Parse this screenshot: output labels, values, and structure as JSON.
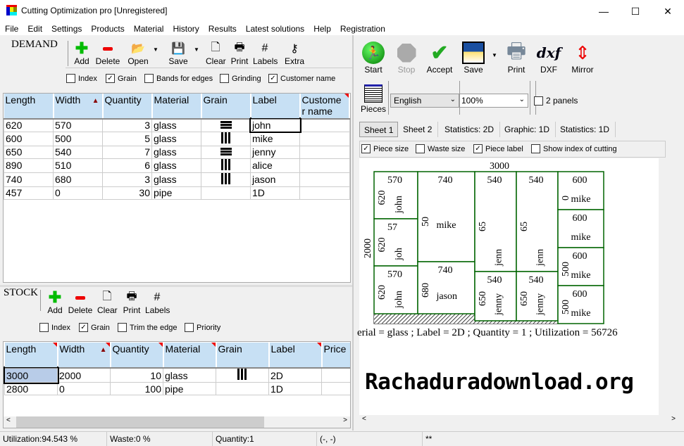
{
  "window": {
    "title": "Cutting Optimization pro [Unregistered]",
    "minimize": "—",
    "maximize": "☐",
    "close": "✕"
  },
  "menu": [
    "File",
    "Edit",
    "Settings",
    "Products",
    "Material",
    "History",
    "Results",
    "Latest solutions",
    "Help",
    "Registration"
  ],
  "demand": {
    "title": "DEMAND",
    "toolbar": {
      "add": "Add",
      "delete": "Delete",
      "open": "Open",
      "save": "Save",
      "clear": "Clear",
      "print": "Print",
      "labels": "Labels",
      "extra": "Extra"
    },
    "options": [
      {
        "label": "Index",
        "checked": false
      },
      {
        "label": "Grain",
        "checked": true
      },
      {
        "label": "Bands for edges",
        "checked": false
      },
      {
        "label": "Grinding",
        "checked": false
      },
      {
        "label": "Customer name",
        "checked": true
      }
    ],
    "columns": [
      "Length",
      "Width",
      "Quantity",
      "Material",
      "Grain",
      "Label",
      "Custome r name"
    ],
    "rows": [
      {
        "length": "620",
        "width": "570",
        "quantity": "3",
        "material": "glass",
        "grain": "horizontal",
        "label": "john",
        "customer": ""
      },
      {
        "length": "600",
        "width": "500",
        "quantity": "5",
        "material": "glass",
        "grain": "vertical",
        "label": "mike",
        "customer": ""
      },
      {
        "length": "650",
        "width": "540",
        "quantity": "7",
        "material": "glass",
        "grain": "horizontal",
        "label": "jenny",
        "customer": ""
      },
      {
        "length": "890",
        "width": "510",
        "quantity": "6",
        "material": "glass",
        "grain": "vertical",
        "label": "alice",
        "customer": ""
      },
      {
        "length": "740",
        "width": "680",
        "quantity": "3",
        "material": "glass",
        "grain": "vertical",
        "label": "jason",
        "customer": ""
      },
      {
        "length": "457",
        "width": "0",
        "quantity": "30",
        "material": "pipe",
        "grain": "none",
        "label": "1D",
        "customer": ""
      }
    ]
  },
  "stock": {
    "title": "STOCK",
    "toolbar": {
      "add": "Add",
      "delete": "Delete",
      "clear": "Clear",
      "print": "Print",
      "labels": "Labels"
    },
    "options": [
      {
        "label": "Index",
        "checked": false
      },
      {
        "label": "Grain",
        "checked": true
      },
      {
        "label": "Trim the edge",
        "checked": false
      },
      {
        "label": "Priority",
        "checked": false
      }
    ],
    "columns": [
      "Length",
      "Width",
      "Quantity",
      "Material",
      "Grain",
      "Label",
      "Price"
    ],
    "rows": [
      {
        "length": "3000",
        "width": "2000",
        "quantity": "10",
        "material": "glass",
        "grain": "vertical",
        "label": "2D",
        "price": ""
      },
      {
        "length": "2800",
        "width": "0",
        "quantity": "100",
        "material": "pipe",
        "grain": "none",
        "label": "1D",
        "price": ""
      }
    ]
  },
  "right": {
    "toolbar": {
      "start": "Start",
      "stop": "Stop",
      "accept": "Accept",
      "save": "Save",
      "print": "Print",
      "dxf": "DXF",
      "dxf_icon": "dxf",
      "mirror": "Mirror",
      "pieces": "Pieces"
    },
    "language": "English",
    "zoom": "100%",
    "two_panels": {
      "label": "2 panels",
      "checked": false
    },
    "tabs": [
      "Sheet 1",
      "Sheet 2",
      "Statistics: 2D",
      "Graphic: 1D",
      "Statistics: 1D"
    ],
    "active_tab": "Sheet 1",
    "view_options": [
      {
        "label": "Piece size",
        "checked": true
      },
      {
        "label": "Waste size",
        "checked": false
      },
      {
        "label": "Piece label",
        "checked": true
      },
      {
        "label": "Show index of cutting",
        "checked": false
      }
    ],
    "sheet": {
      "length": "3000",
      "width": "2000",
      "pieces": [
        {
          "w": "570",
          "h": "620",
          "label": "john"
        },
        {
          "w": "57",
          "h": "620",
          "label": "joh"
        },
        {
          "w": "570",
          "h": "620",
          "label": "john"
        },
        {
          "w": "740",
          "h": "50",
          "label": "mike"
        },
        {
          "w": "740",
          "h": "680",
          "label": "jason"
        },
        {
          "w": "540",
          "h": "65",
          "label": "jenn"
        },
        {
          "w": "540",
          "h": "65",
          "label": "jenn"
        },
        {
          "w": "540",
          "h": "650",
          "label": "jenny"
        },
        {
          "w": "540",
          "h": "650",
          "label": "jenny"
        },
        {
          "w": "600",
          "h": "0",
          "label": "mike"
        },
        {
          "w": "600",
          "h": "",
          "label": "mike"
        },
        {
          "w": "600",
          "h": "500",
          "label": "mike"
        },
        {
          "w": "600",
          "h": "500",
          "label": "mike"
        }
      ],
      "info": "erial = glass ; Label = 2D ; Quantity = 1 ; Utilization = 56726"
    },
    "watermark": "Rachaduradownload.org"
  },
  "status": {
    "utilization": "Utilization:94.543 %",
    "waste": "Waste:0 %",
    "quantity": "Quantity:1",
    "coords": "(-, -)",
    "extra": "**"
  },
  "colors": {
    "header": "#c7e0f4",
    "piece_border": "#006400",
    "accent_red": "#e00000"
  }
}
